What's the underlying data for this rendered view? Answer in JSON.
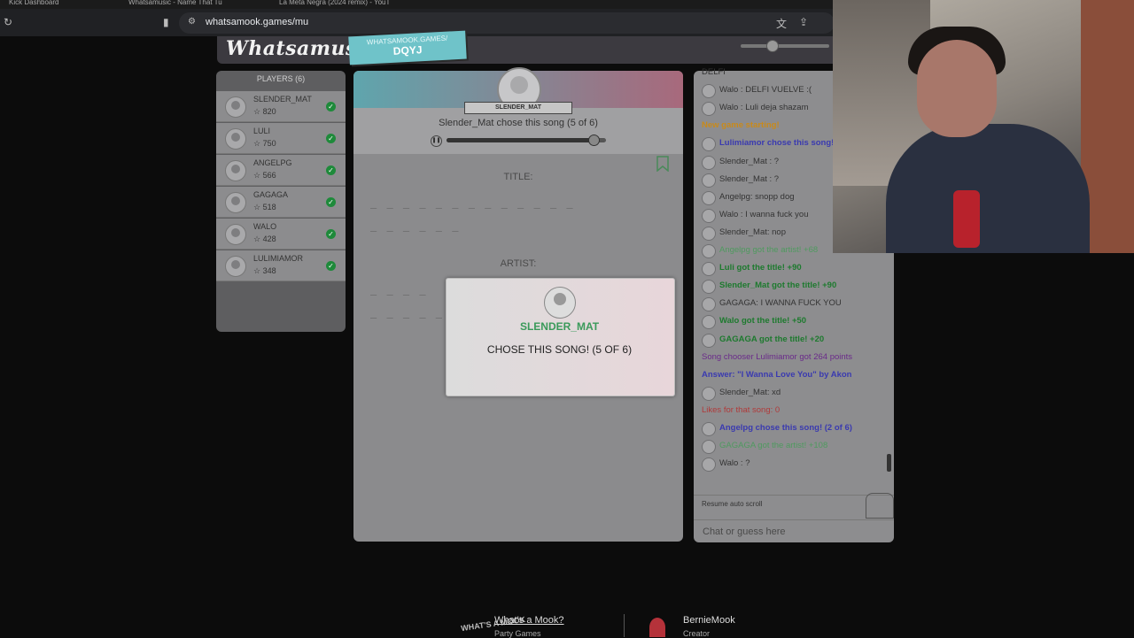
{
  "browser": {
    "tabs": [
      {
        "label": "Kick Dashboard"
      },
      {
        "label": "Whatsamusic - Name That Tu"
      },
      {
        "label": "La Meta Negra (2024 remix) - YouT"
      }
    ],
    "url": "whatsamook.games/mu"
  },
  "header": {
    "logo": "Whatsamusic",
    "game_code_label": "WHATSAMOOK.GAMES/",
    "game_code": "DQYJ"
  },
  "players": {
    "heading": "PLAYERS (6)",
    "list": [
      {
        "name": "SLENDER_MAT",
        "points": "820"
      },
      {
        "name": "LULI",
        "points": "750"
      },
      {
        "name": "ANGELPG",
        "points": "566"
      },
      {
        "name": "GAGAGA",
        "points": "518"
      },
      {
        "name": "WALO",
        "points": "428"
      },
      {
        "name": "LULIMIAMOR",
        "points": "348"
      }
    ]
  },
  "stage": {
    "chooser_banner": "SLENDER_MAT",
    "chooser_line": "Slender_Mat chose this song (5 of 6)",
    "playback_progress": 0.92,
    "title_label": "TITLE:",
    "title_dashes_1": "_ _   _ _   _ _ _ _ _ _ _   _ _",
    "title_dashes_2": "_ _ _ _ _ _",
    "artist_label": "ARTIST:",
    "artist_dashes_1": "_ _   _ _",
    "artist_dashes_2": "_ _ _ _ _"
  },
  "modal": {
    "name": "SLENDER_MAT",
    "message": "CHOSE THIS SONG! (5 OF 6)"
  },
  "chat": {
    "messages": [
      {
        "text": "DELFI",
        "color": "#333333",
        "avatar": false,
        "bold": false
      },
      {
        "text": "Walo : DELFI VUELVE :(",
        "color": "#333333",
        "avatar": true,
        "bold": false
      },
      {
        "text": "Walo : Luli deja shazam",
        "color": "#333333",
        "avatar": true,
        "bold": false
      },
      {
        "text": "New game starting!",
        "color": "#c98a1a",
        "avatar": false,
        "bold": true
      },
      {
        "text": "Lulimiamor chose this song! (1 of 6)",
        "color": "#3a3ab0",
        "avatar": true,
        "bold": true
      },
      {
        "text": "Slender_Mat : ?",
        "color": "#333333",
        "avatar": true,
        "bold": false
      },
      {
        "text": "Slender_Mat : ?",
        "color": "#333333",
        "avatar": true,
        "bold": false
      },
      {
        "text": "Angelpg: snopp dog",
        "color": "#333333",
        "avatar": true,
        "bold": false
      },
      {
        "text": "Walo : I wanna fuck you",
        "color": "#333333",
        "avatar": true,
        "bold": false
      },
      {
        "text": "Slender_Mat: nop",
        "color": "#333333",
        "avatar": true,
        "bold": false
      },
      {
        "text": "Angelpg got the artist! +68",
        "color": "#4f9a5f",
        "avatar": true,
        "bold": false
      },
      {
        "text": "Luli got the title! +90",
        "color": "#1d7a2e",
        "avatar": true,
        "bold": true
      },
      {
        "text": "Slender_Mat got the title! +90",
        "color": "#1d7a2e",
        "avatar": true,
        "bold": true
      },
      {
        "text": "GAGAGA: I WANNA FUCK YOU",
        "color": "#333333",
        "avatar": true,
        "bold": false
      },
      {
        "text": "Walo got the title! +50",
        "color": "#1d7a2e",
        "avatar": true,
        "bold": true
      },
      {
        "text": "GAGAGA got the title! +20",
        "color": "#1d7a2e",
        "avatar": true,
        "bold": true
      },
      {
        "text": "Song chooser Lulimiamor got 264 points",
        "color": "#6a2a8a",
        "avatar": false,
        "bold": false
      },
      {
        "text": "Answer: \"I Wanna Love You\" by Akon",
        "color": "#3a3ab0",
        "avatar": false,
        "bold": true
      },
      {
        "text": "Slender_Mat: xd",
        "color": "#333333",
        "avatar": true,
        "bold": false
      },
      {
        "text": "Likes for that song: 0",
        "color": "#b03a3a",
        "avatar": false,
        "bold": false
      },
      {
        "text": "Angelpg chose this song! (2 of 6)",
        "color": "#3a3ab0",
        "avatar": true,
        "bold": true
      },
      {
        "text": "GAGAGA got the artist! +108",
        "color": "#4f9a5f",
        "avatar": true,
        "bold": false
      },
      {
        "text": "Walo : ?",
        "color": "#333333",
        "avatar": true,
        "bold": false
      }
    ],
    "resume_label": "Resume auto scroll",
    "input_placeholder": "Chat or guess here"
  },
  "footer": {
    "logo": "WHAT'S A MOOK",
    "link1": "What's a Mook?",
    "link1_sub": "Party Games",
    "link2": "BernieMook",
    "link2_sub": "Creator"
  },
  "colors": {
    "accent_green": "#3a9a5a",
    "teal": "#6fc3c9"
  }
}
